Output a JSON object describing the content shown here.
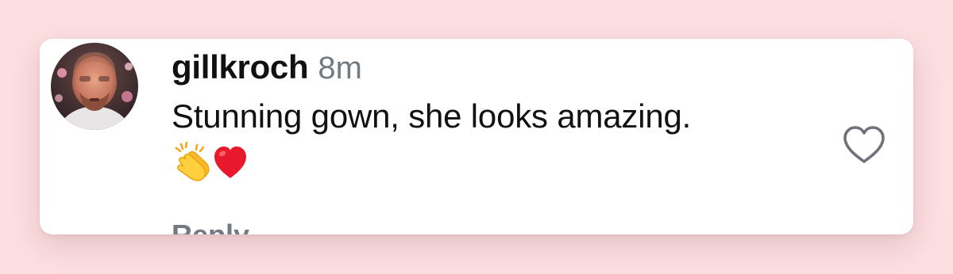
{
  "comment": {
    "username": "gillkroch",
    "timestamp": "8m",
    "text": "Stunning gown, she looks amazing.",
    "emojis": [
      "clapping-hands",
      "red-heart"
    ],
    "reply_label": "Reply"
  },
  "colors": {
    "page_background": "#fcdfe0",
    "card_background": "#ffffff",
    "text_primary": "#111111",
    "text_secondary": "#737a84",
    "heart_outline": "#6e737b"
  },
  "icons": {
    "like": "heart-outline-icon",
    "avatar": "user-avatar-photo"
  }
}
